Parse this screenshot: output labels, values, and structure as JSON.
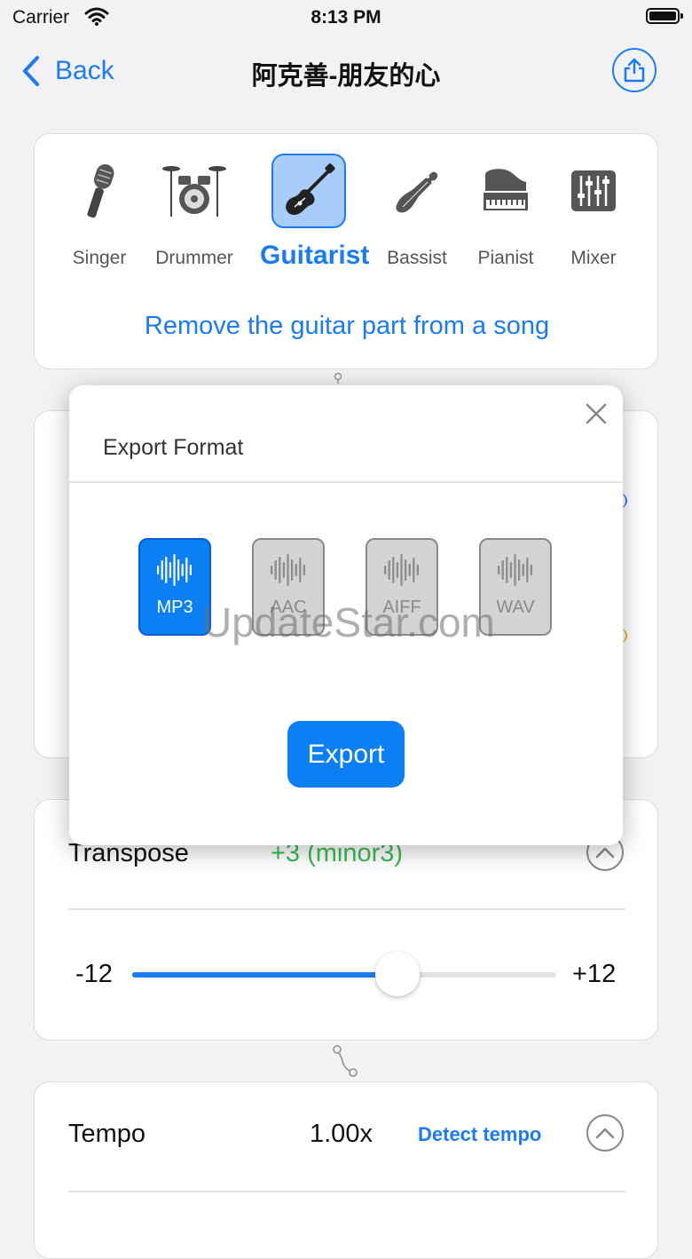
{
  "status_bar": {
    "carrier": "Carrier",
    "time": "8:13 PM"
  },
  "nav": {
    "back_label": "Back",
    "title": "阿克善-朋友的心"
  },
  "roles": {
    "items": [
      {
        "label": "Singer",
        "icon": "microphone-icon"
      },
      {
        "label": "Drummer",
        "icon": "drum-kit-icon"
      },
      {
        "label": "Guitarist",
        "icon": "electric-guitar-icon",
        "selected": true
      },
      {
        "label": "Bassist",
        "icon": "bass-guitar-icon"
      },
      {
        "label": "Pianist",
        "icon": "grand-piano-icon"
      },
      {
        "label": "Mixer",
        "icon": "mixer-sliders-icon"
      }
    ],
    "subtitle": "Remove the guitar part from a song"
  },
  "dialog": {
    "title": "Export Format",
    "formats": [
      {
        "label": "MP3",
        "selected": true
      },
      {
        "label": "AAC",
        "selected": false
      },
      {
        "label": "AIFF",
        "selected": false
      },
      {
        "label": "WAV",
        "selected": false
      }
    ],
    "export_label": "Export"
  },
  "transpose": {
    "label": "Transpose",
    "value": "+3 (minor3)",
    "min_label": "-12",
    "max_label": "+12",
    "slider_min": -12,
    "slider_max": 12,
    "slider_value": 3
  },
  "tempo": {
    "label": "Tempo",
    "value": "1.00x",
    "detect_label": "Detect tempo"
  },
  "watermark": "UpdateStar.com",
  "colors": {
    "accent": "#1a7cf5",
    "positive": "#3cba54",
    "selected_role_bg": "#a9cdfb"
  }
}
